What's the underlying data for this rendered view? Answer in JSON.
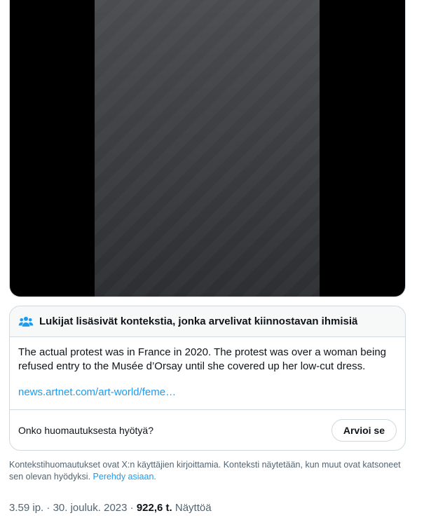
{
  "media": {
    "type": "video",
    "frame_bg": "#3f4145",
    "letterbox_color": "#000000"
  },
  "note": {
    "icon": "people-icon",
    "title": "Lukijat lisäsivät kontekstia, jonka arvelivat kiinnostavan ihmisiä",
    "text": "The actual protest was in France in 2020. The protest was over a woman being refused entry to the Musée d’Orsay until she covered up her low-cut dress.",
    "link": "news.artnet.com/art-world/feme…",
    "helpful_question": "Onko huomautuksesta hyötyä?",
    "rate_label": "Arvioi se"
  },
  "disclaimer": {
    "text": "Kontekstihuomautukset ovat X:n käyttäjien kirjoittamia. Konteksti näytetään, kun muut ovat katsoneet sen olevan hyödyksi.",
    "link": "Perehdy asiaan."
  },
  "meta": {
    "time": "3.59 ip.",
    "separator": "·",
    "date": "30. jouluk. 2023",
    "views_count": "922,6 t.",
    "views_label": "Näyttöä"
  },
  "colors": {
    "accent": "#1d9bf0",
    "text_primary": "#0f1419",
    "text_secondary": "#536471",
    "border": "#cfd9de"
  }
}
